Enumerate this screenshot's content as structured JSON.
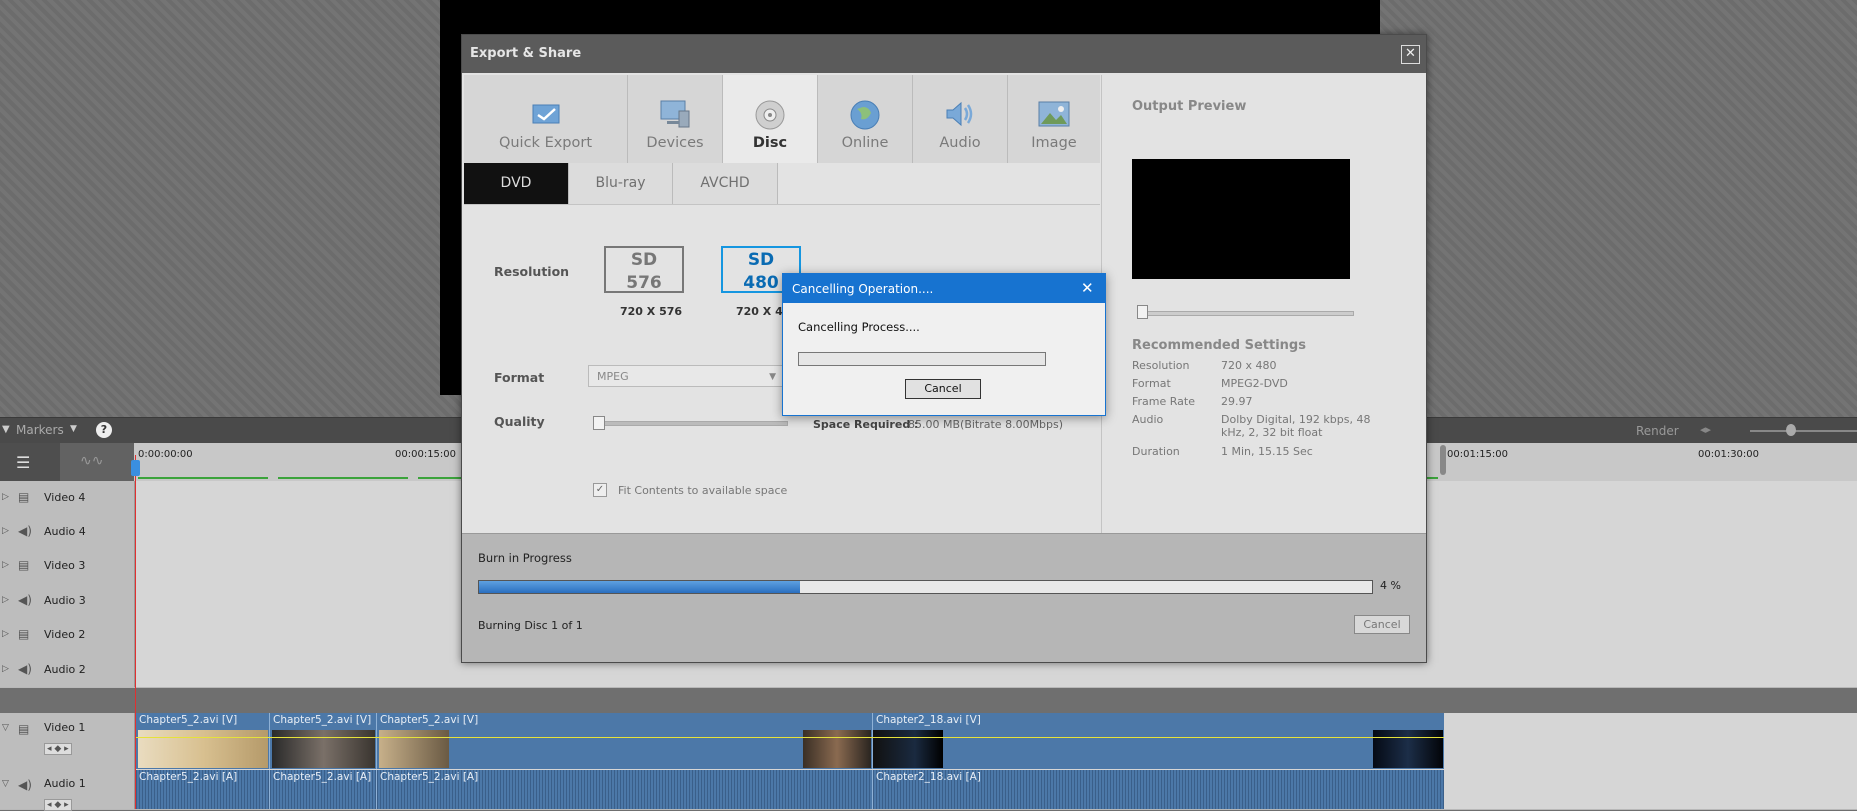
{
  "timeline": {
    "markers_label": "Markers",
    "help_glyph": "?",
    "render_label": "Render",
    "ruler_ticks": [
      "0:00:00:00",
      "00:00:15:00",
      "00:01:15:00",
      "00:01:30:00"
    ],
    "tracks": [
      {
        "label": "Video 4",
        "type": "video"
      },
      {
        "label": "Audio 4",
        "type": "audio"
      },
      {
        "label": "Video 3",
        "type": "video"
      },
      {
        "label": "Audio 3",
        "type": "audio"
      },
      {
        "label": "Video 2",
        "type": "video"
      },
      {
        "label": "Audio 2",
        "type": "audio"
      },
      {
        "label": "Video 1",
        "type": "video"
      },
      {
        "label": "Audio 1",
        "type": "audio"
      }
    ],
    "video_clips": [
      "Chapter5_2.avi [V]",
      "Chapter5_2.avi [V]",
      "Chapter5_2.avi [V]",
      "Chapter2_18.avi [V]"
    ],
    "audio_clips": [
      "Chapter5_2.avi [A]",
      "Chapter5_2.avi [A]",
      "Chapter5_2.avi [A]",
      "Chapter2_18.avi [A]"
    ]
  },
  "dialog": {
    "title": "Export & Share",
    "close_glyph": "✕",
    "tabs": [
      {
        "label": "Quick Export",
        "icon": "quick-export-icon"
      },
      {
        "label": "Devices",
        "icon": "devices-icon"
      },
      {
        "label": "Disc",
        "icon": "disc-icon",
        "active": true
      },
      {
        "label": "Online",
        "icon": "globe-icon"
      },
      {
        "label": "Audio",
        "icon": "speaker-icon"
      },
      {
        "label": "Image",
        "icon": "image-icon"
      }
    ],
    "subtabs": [
      "DVD",
      "Blu-ray",
      "AVCHD"
    ],
    "resolution_label": "Resolution",
    "res_options": [
      {
        "line1": "SD",
        "line2": "576",
        "caption": "720 X 576"
      },
      {
        "line1": "SD",
        "line2": "480",
        "caption": "720 X 480"
      }
    ],
    "format_label": "Format",
    "format_value": "MPEG",
    "quality_label": "Quality",
    "space_required_label": "Space Required :",
    "space_required_value": "85.00 MB(Bitrate 8.00Mbps)",
    "fit_contents_label": "Fit Contents to available space",
    "fit_contents_checked": true,
    "output_preview_title": "Output Preview",
    "recommended_title": "Recommended Settings",
    "recommended": [
      {
        "key": "Resolution",
        "value": "720 x 480"
      },
      {
        "key": "Format",
        "value": "MPEG2-DVD"
      },
      {
        "key": "Frame Rate",
        "value": "29.97"
      },
      {
        "key": "Audio",
        "value": "Dolby Digital, 192 kbps, 48 kHz, 2, 32 bit float"
      },
      {
        "key": "Duration",
        "value": "1 Min, 15.15 Sec"
      }
    ],
    "burn_label": "Burn in Progress",
    "burn_progress": 0.04,
    "burn_percent_text": "4 %",
    "burn_disc_text": "Burning Disc 1 of 1",
    "burn_cancel_label": "Cancel"
  },
  "modal": {
    "title": "Cancelling Operation....",
    "close_glyph": "✕",
    "message": "Cancelling Process....",
    "cancel_label": "Cancel"
  },
  "colors": {
    "accent_blue": "#1773d0",
    "selected_res": "#1596e0",
    "clip_blue": "#4c78a8"
  }
}
